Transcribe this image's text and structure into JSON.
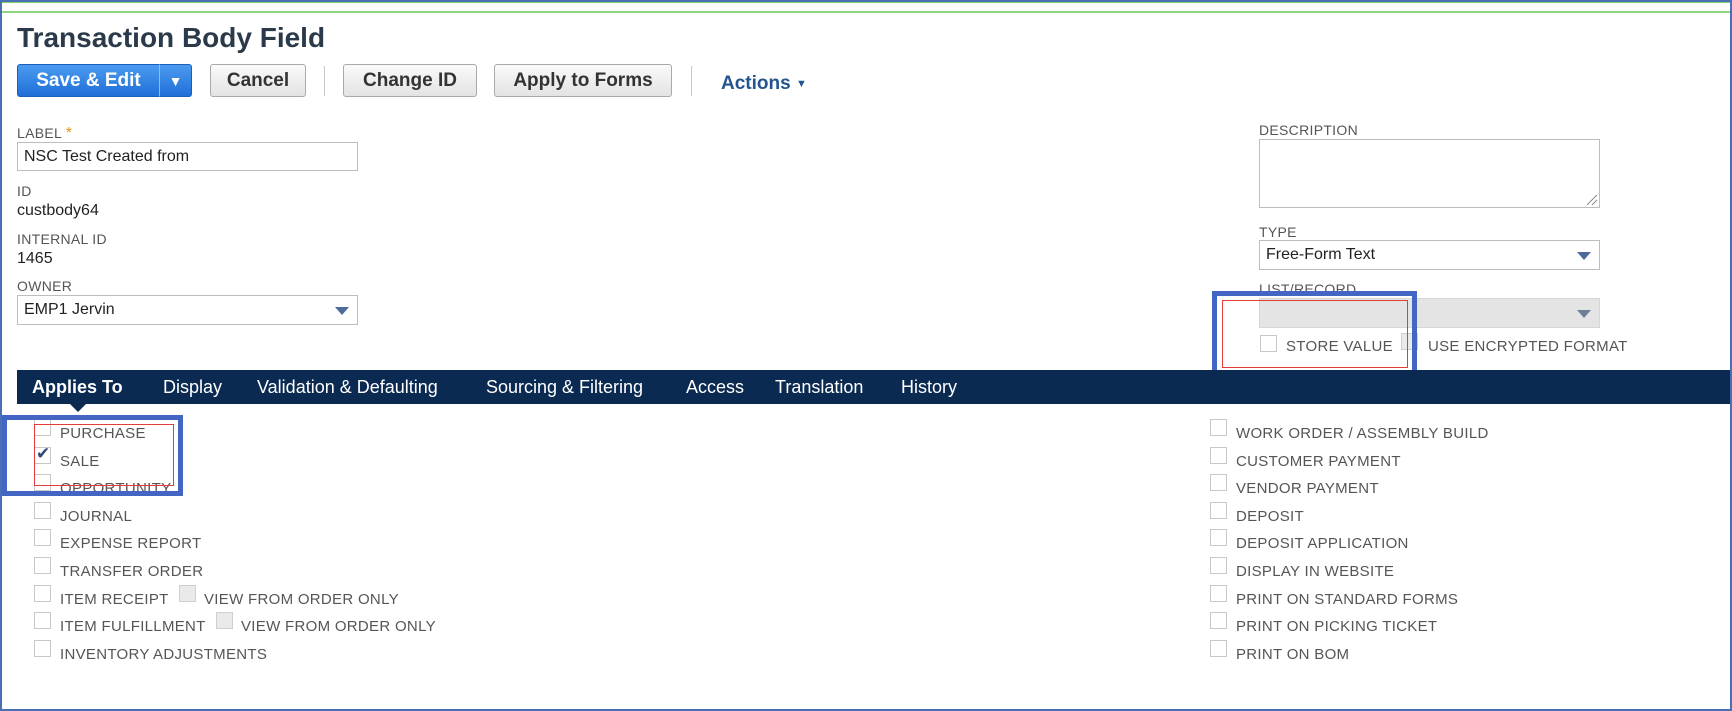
{
  "page_title": "Transaction Body Field",
  "toolbar": {
    "save_edit": "Save & Edit",
    "cancel": "Cancel",
    "change_id": "Change ID",
    "apply_forms": "Apply to Forms",
    "actions": "Actions"
  },
  "form": {
    "label_label": "LABEL",
    "label_value": "NSC Test Created from",
    "id_label": "ID",
    "id_value": "custbody64",
    "internal_id_label": "INTERNAL ID",
    "internal_id_value": "1465",
    "owner_label": "OWNER",
    "owner_value": "EMP1 Jervin",
    "description_label": "DESCRIPTION",
    "type_label": "TYPE",
    "type_value": "Free-Form Text",
    "list_record_label": "LIST/RECORD",
    "store_value_label": "STORE VALUE",
    "encrypted_label": "USE ENCRYPTED FORMAT"
  },
  "tabs": [
    {
      "label": "Applies To",
      "active": true
    },
    {
      "label": "Display"
    },
    {
      "label": "Validation & Defaulting"
    },
    {
      "label": "Sourcing & Filtering"
    },
    {
      "label": "Access"
    },
    {
      "label": "Translation"
    },
    {
      "label": "History"
    }
  ],
  "applies_left": [
    {
      "label": "PURCHASE",
      "checked": false
    },
    {
      "label": "SALE",
      "checked": true
    },
    {
      "label": "OPPORTUNITY",
      "checked": false
    },
    {
      "label": "JOURNAL",
      "checked": false
    },
    {
      "label": "EXPENSE REPORT",
      "checked": false
    },
    {
      "label": "TRANSFER ORDER",
      "checked": false
    },
    {
      "label": "ITEM RECEIPT",
      "checked": false
    },
    {
      "label": "ITEM FULFILLMENT",
      "checked": false
    },
    {
      "label": "INVENTORY ADJUSTMENTS",
      "checked": false
    }
  ],
  "view_from_order_only": "VIEW FROM ORDER ONLY",
  "applies_right": [
    {
      "label": "WORK ORDER / ASSEMBLY BUILD",
      "checked": false
    },
    {
      "label": "CUSTOMER PAYMENT",
      "checked": false
    },
    {
      "label": "VENDOR PAYMENT",
      "checked": false
    },
    {
      "label": "DEPOSIT",
      "checked": false
    },
    {
      "label": "DEPOSIT APPLICATION",
      "checked": false
    },
    {
      "label": "DISPLAY IN WEBSITE",
      "checked": false
    },
    {
      "label": "PRINT ON STANDARD FORMS",
      "checked": false
    },
    {
      "label": "PRINT ON PICKING TICKET",
      "checked": false
    },
    {
      "label": "PRINT ON BOM",
      "checked": false
    }
  ],
  "colors": {
    "primary_button": "#1f6fd8",
    "tab_bar": "#0b2a52",
    "highlight_box": "#4366c4",
    "required_marker": "#e8941a"
  }
}
